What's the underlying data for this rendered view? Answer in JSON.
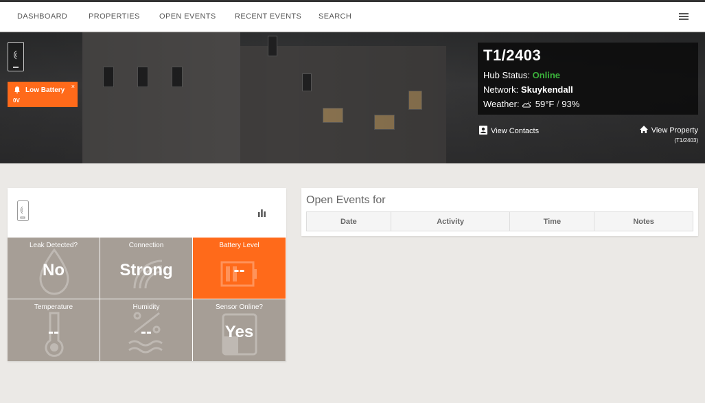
{
  "nav": {
    "items": [
      "DASHBOARD",
      "PROPERTIES",
      "OPEN EVENTS",
      "RECENT EVENTS",
      "SEARCH"
    ]
  },
  "alert": {
    "title": "Low Battery",
    "value": "0V",
    "close": "×"
  },
  "hub": {
    "id": "T1/2403",
    "status_label": "Hub Status:",
    "status_value": "Online",
    "network_label": "Network:",
    "network_value": "Skuykendall",
    "weather_label": "Weather:",
    "weather_temp": "59°F",
    "weather_sep": "/",
    "weather_humidity": "93%"
  },
  "links": {
    "contacts": "View Contacts",
    "property": "View Property",
    "property_sub": "(T1/2403)"
  },
  "tiles": [
    {
      "label": "Leak Detected?",
      "value": "No"
    },
    {
      "label": "Connection",
      "value": "Strong"
    },
    {
      "label": "Battery Level",
      "value": "--"
    },
    {
      "label": "Temperature",
      "value": "--"
    },
    {
      "label": "Humidity",
      "value": "--"
    },
    {
      "label": "Sensor Online?",
      "value": "Yes"
    }
  ],
  "events": {
    "title": "Open Events for",
    "columns": [
      "Date",
      "Activity",
      "Time",
      "Notes"
    ]
  },
  "colors": {
    "accent": "#ff6a1a",
    "tile": "#a69e96",
    "online": "#3bb33b"
  }
}
